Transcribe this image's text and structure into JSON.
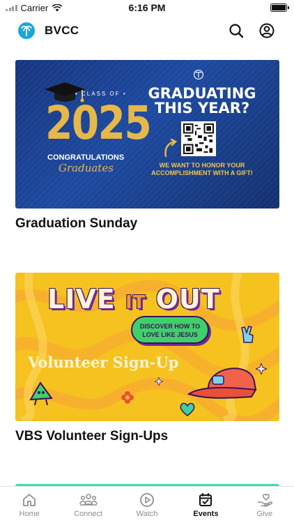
{
  "status_bar": {
    "carrier": "Carrier",
    "time": "6:16 PM"
  },
  "header": {
    "title": "BVCC",
    "search_icon": "search-icon",
    "account_icon": "account-icon"
  },
  "events": [
    {
      "title": "Graduation Sunday",
      "banner": {
        "class_of": "• CLASS OF •",
        "year": "2025",
        "congrats": "CONGRATULATIONS",
        "graduates": "Graduates",
        "headline": "GRADUATING THIS YEAR?",
        "subline": "WE WANT TO HONOR YOUR ACCOMPLISHMENT WITH A GIFT!"
      }
    },
    {
      "title": "VBS Volunteer Sign-Ups",
      "banner": {
        "live": "LIVE",
        "it": "IT",
        "out": "OUT",
        "tagline": "DISCOVER HOW TO LOVE LIKE JESUS",
        "volunteer": "Volunteer Sign-Up"
      }
    }
  ],
  "tabbar": {
    "active": "Events",
    "tabs": [
      {
        "label": "Home",
        "icon": "home-icon"
      },
      {
        "label": "Connect",
        "icon": "people-icon"
      },
      {
        "label": "Watch",
        "icon": "play-icon"
      },
      {
        "label": "Events",
        "icon": "calendar-icon"
      },
      {
        "label": "Give",
        "icon": "give-heart-icon"
      }
    ]
  },
  "colors": {
    "accent": "#1aa6d9",
    "grad_blue": "#1d4aa0",
    "grad_gold": "#e6b84a",
    "vbs_yellow": "#f6c21f",
    "tab_inactive": "#8e8e8e"
  }
}
